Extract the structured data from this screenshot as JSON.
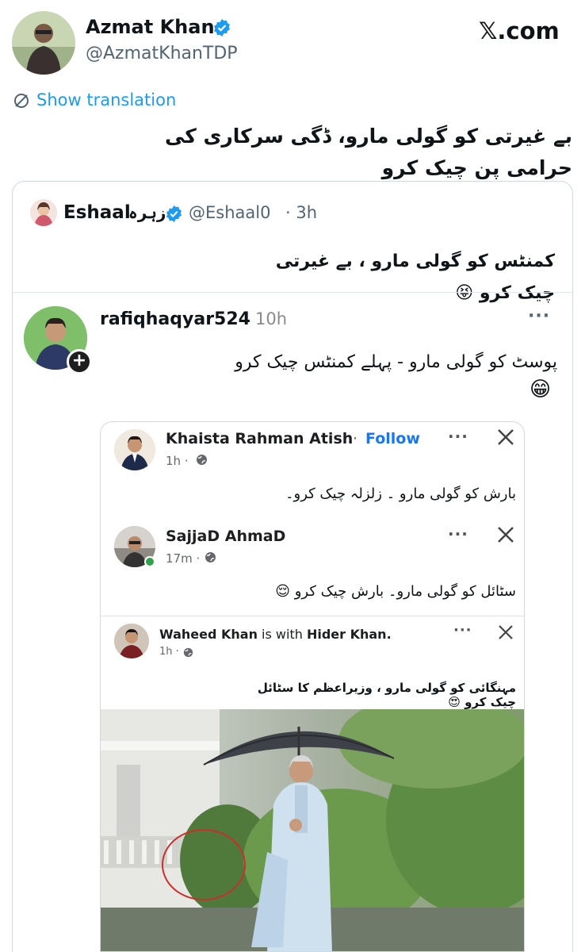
{
  "tweet": {
    "author_name": "Azmat Khan",
    "author_handle": "@AzmatKhanTDP",
    "brand": "𝕏.com",
    "translate_label": "Show translation",
    "text": "بے غیرتی کو گولی مارو، ڈگی سرکاری کی حرامی پن چیک کرو"
  },
  "quote": {
    "name": "Eshaal",
    "name_urdu": "زہرہ",
    "handle": "@Eshaal0",
    "time": "· 3h",
    "text": "کمنٹس کو گولی مارو ، بے غیرتی چیک کرو",
    "emoji": "😝"
  },
  "reply": {
    "username": "rafiqhaqyar524",
    "time": "10h",
    "text": "پوسٹ کو گولی مارو - پہلے کمنٹس چیک کرو",
    "emoji": "😁"
  },
  "fb_post1": {
    "name": "Khaista Rahman Atish",
    "sep": "·",
    "follow": "Follow",
    "time": "1h ·",
    "text": "بارش کو گولی مارو ۔ زلزلہ چیک کرو۔"
  },
  "fb_post2": {
    "name": "SajjaD AhmaD",
    "time": "17m ·",
    "text": "سٹائل کو گولی مارو۔ بارش چیک کرو",
    "emoji": "😌"
  },
  "fb_post3": {
    "name1": "Waheed Khan",
    "with": " is with ",
    "name2": "Hider Khan.",
    "time": "1h ·",
    "text": "مہنگائی کو گولی مارو ، وزیراعظم کا سٹائل چیک کرو",
    "emoji": "😍"
  },
  "colors": {
    "accent": "#1d9bf0",
    "fb_blue": "#1877f2"
  }
}
